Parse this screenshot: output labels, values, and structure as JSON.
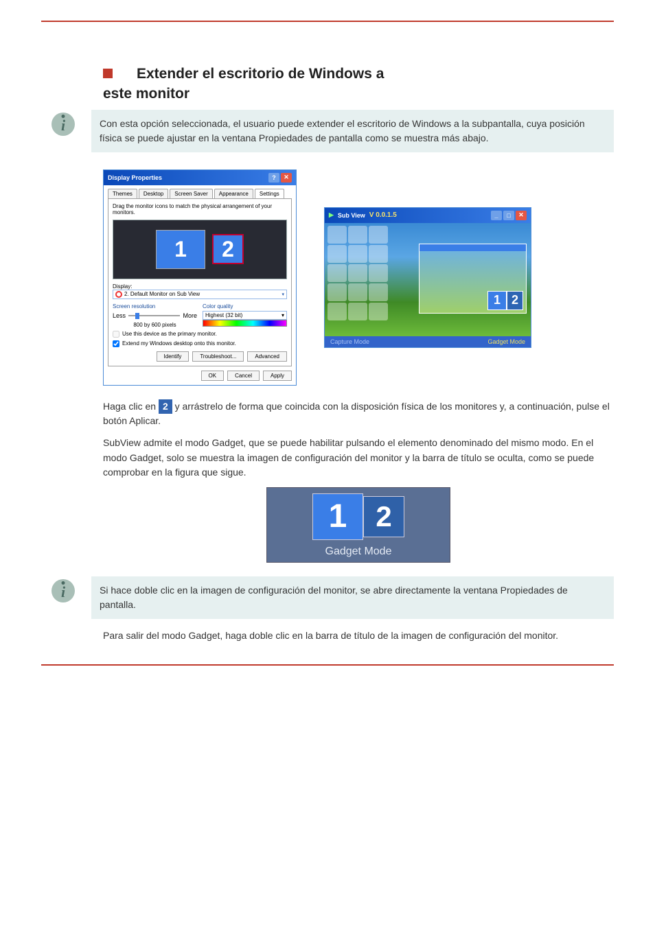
{
  "header_rule": true,
  "section1": {
    "title_prefix": "Extender el escritorio de Windows a",
    "title_line2": "este monitor",
    "note": "Con esta opción seleccionada, el usuario puede extender el escritorio de Windows a la subpantalla, cuya posición física se puede ajustar en la ventana Propiedades de pantalla como se muestra más abajo."
  },
  "display_properties": {
    "title": "Display Properties",
    "tabs": [
      "Themes",
      "Desktop",
      "Screen Saver",
      "Appearance",
      "Settings"
    ],
    "active_tab_index": 4,
    "drag_text": "Drag the monitor icons to match the physical arrangement of your monitors.",
    "mon1": "1",
    "mon2": "2",
    "display_label": "Display:",
    "display_value": "2. Default Monitor on Sub View",
    "screen_res": "Screen resolution",
    "less": "Less",
    "more": "More",
    "res_value": "800 by 600 pixels",
    "color_quality": "Color quality",
    "color_value": "Highest (32 bit)",
    "check1": "Use this device as the primary monitor.",
    "check2": "Extend my Windows desktop onto this monitor.",
    "btn_identify": "Identify",
    "btn_troubleshoot": "Troubleshoot...",
    "btn_advanced": "Advanced",
    "btn_ok": "OK",
    "btn_cancel": "Cancel",
    "btn_apply": "Apply"
  },
  "subview": {
    "title": "Sub View",
    "version": "V 0.0.1.5",
    "capture": "Capture Mode",
    "gadget": "Gadget Mode"
  },
  "section2": {
    "body_a": "Haga clic en ",
    "body_b": " y arrástrelo de forma que coincida con la disposición física de los monitores y, a continuación, pulse el botón Aplicar.",
    "body2": "SubView admite el modo Gadget, que se puede habilitar pulsando el elemento denominado del mismo modo. En el modo Gadget, solo se muestra la imagen de configuración del monitor y la barra de título se oculta, como se puede comprobar en la figura que sigue."
  },
  "gadget_box": {
    "n1": "1",
    "n2": "2",
    "label": "Gadget Mode"
  },
  "section3": {
    "note": "Si hace doble clic en la imagen de configuración del monitor, se abre directamente la ventana Propiedades de pantalla.",
    "body": "Para salir del modo Gadget, haga doble clic en la barra de título de la imagen de configuración del monitor."
  }
}
